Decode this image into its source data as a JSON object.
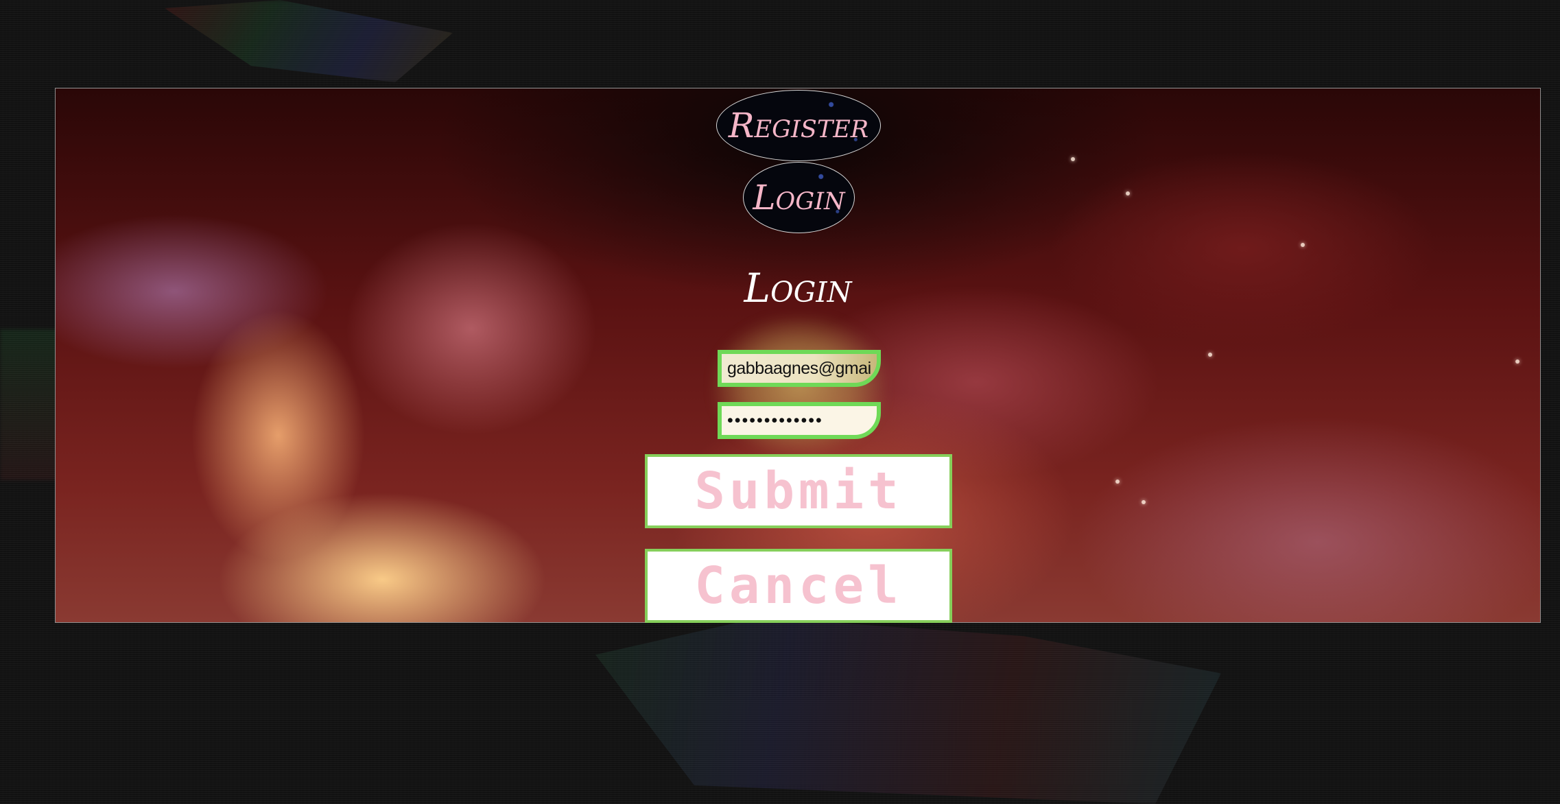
{
  "nav": {
    "register_label": "Register",
    "login_label": "Login"
  },
  "form": {
    "title": "Login",
    "email_value": "gabbaagnes@gmail.co",
    "password_value": "•••••••••••••",
    "submit_label": "Submit",
    "cancel_label": "Cancel"
  },
  "colors": {
    "field_border": "#6fd957",
    "button_border": "#86cf5b",
    "button_text": "#f6c2cf",
    "nav_text": "#f5b6c8"
  }
}
